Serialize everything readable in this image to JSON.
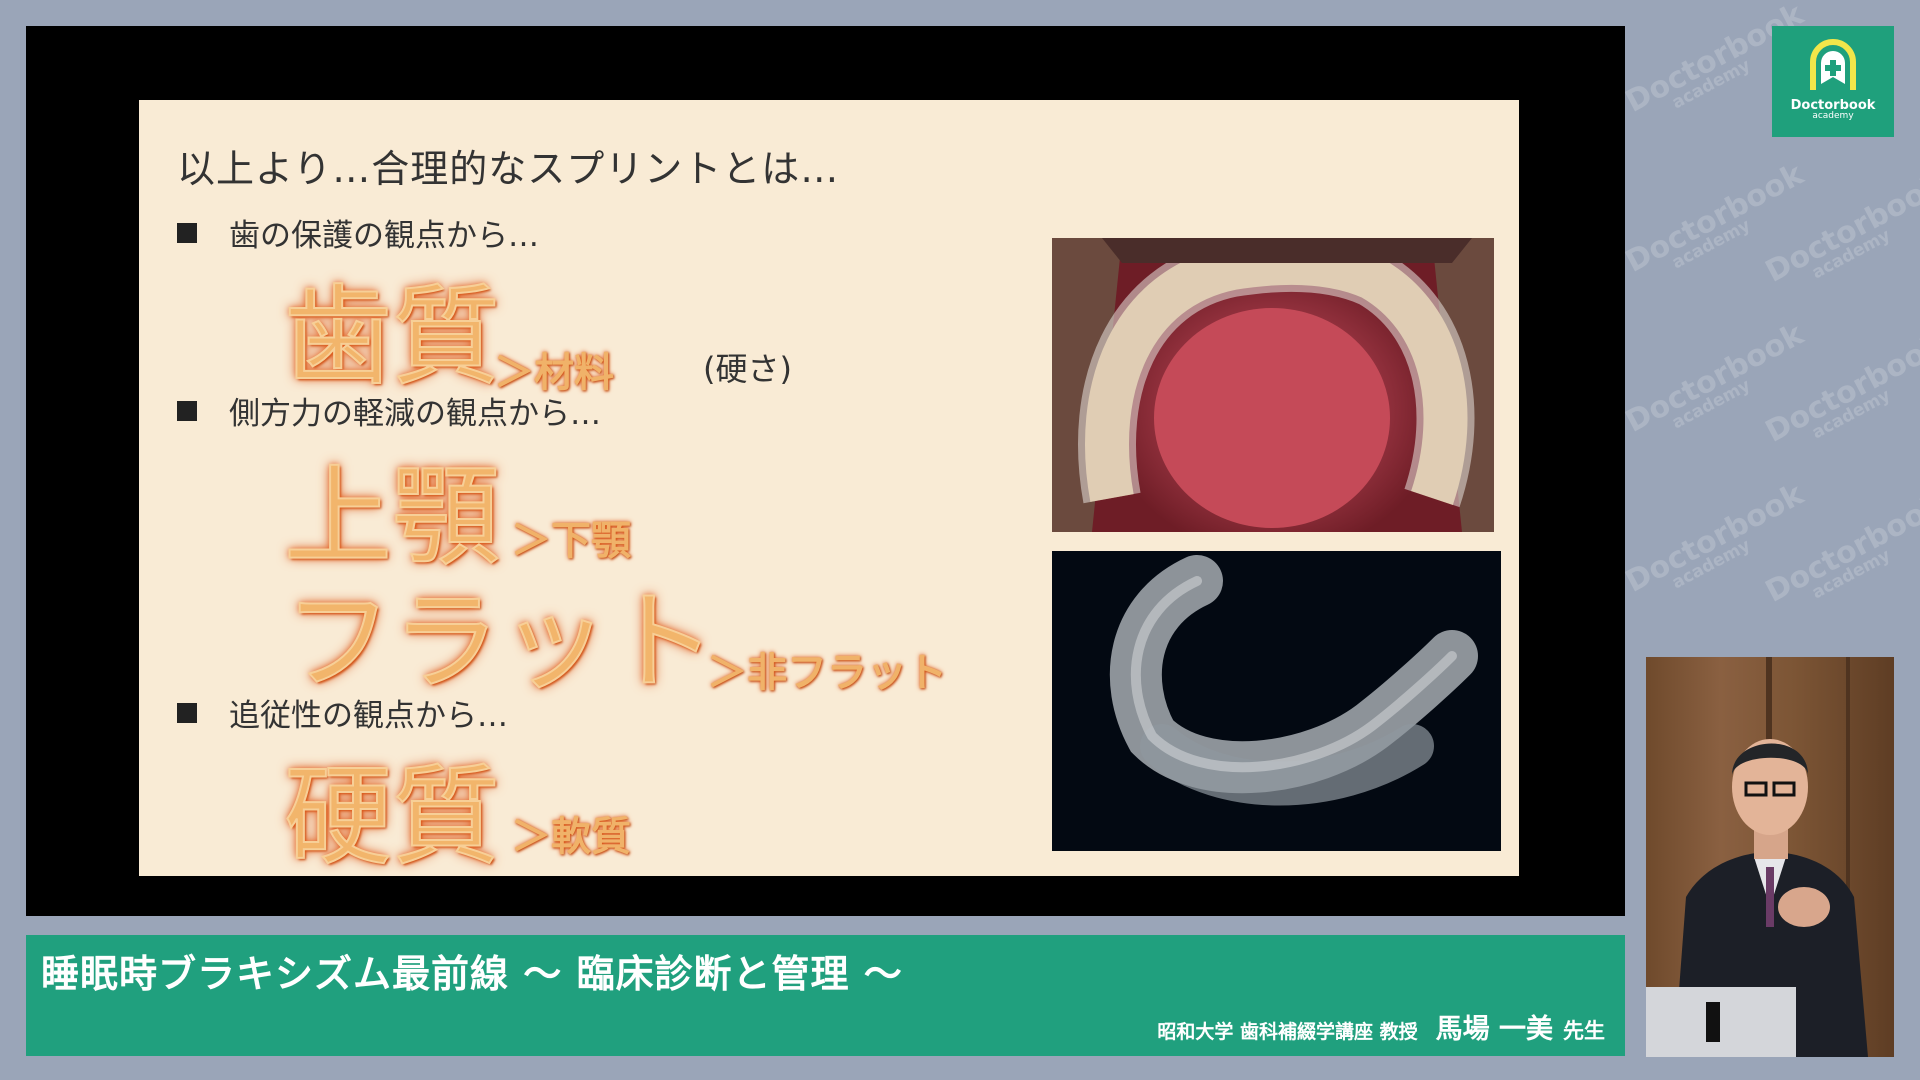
{
  "slide": {
    "heading": "以上より…合理的なスプリントとは…",
    "bullets": [
      "歯の保護の観点から…",
      "側方力の軽減の観点から…",
      "追従性の観点から…"
    ],
    "comparisons": [
      {
        "big": "歯質",
        "small": "＞材料",
        "note": "(硬さ)"
      },
      {
        "big": "上顎",
        "small": "＞下顎"
      },
      {
        "big": "フラット",
        "small": "＞非フラット"
      },
      {
        "big": "硬質",
        "small": "＞軟質"
      }
    ]
  },
  "lower_third": {
    "title": "睡眠時ブラキシズム最前線 〜 臨床診断と管理 〜",
    "affiliation": "昭和大学 歯科補綴学講座 教授",
    "name": "馬場 一美",
    "honorific": "先生"
  },
  "logo": {
    "name": "Doctorbook",
    "sub": "academy",
    "icon": "doctorbook-arch-icon"
  },
  "watermark": {
    "name": "Doctorbook",
    "sub": "academy"
  },
  "colors": {
    "background": "#9aa5b8",
    "slide_bg": "#f9ebd5",
    "accent_green": "#20a07e",
    "highlight_orange": "#f2b56b"
  }
}
